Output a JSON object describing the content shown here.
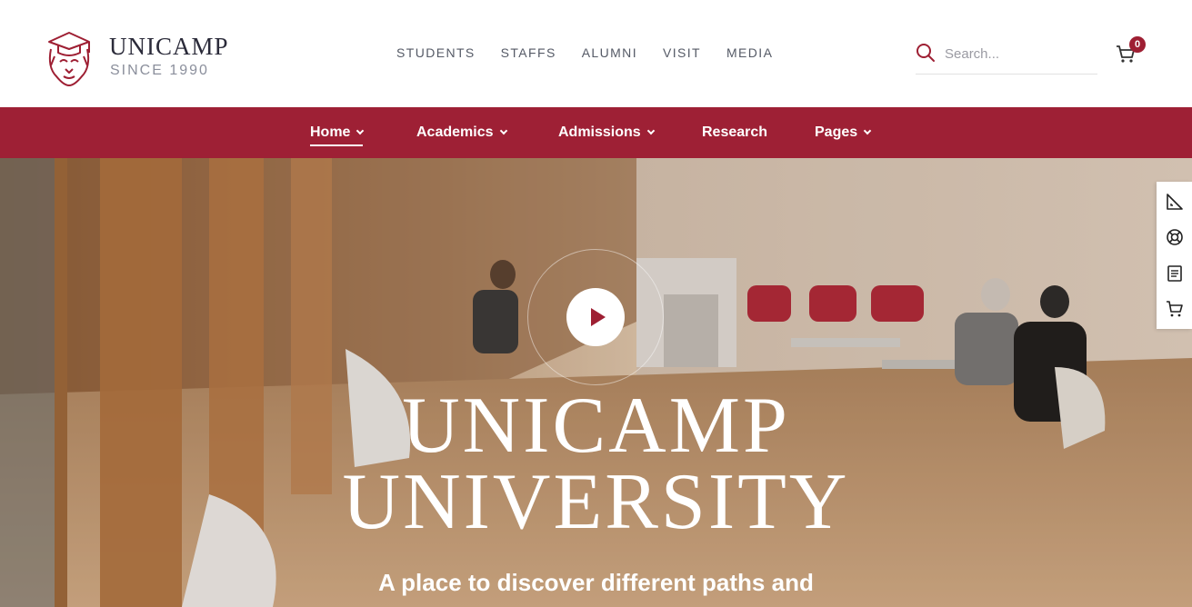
{
  "brand": {
    "name": "UNICAMP",
    "since": "SINCE 1990",
    "colors": {
      "primary": "#9e2035",
      "text": "#2b2b3a"
    }
  },
  "topnav": {
    "items": [
      "STUDENTS",
      "STAFFS",
      "ALUMNI",
      "VISIT",
      "MEDIA"
    ]
  },
  "search": {
    "placeholder": "Search...",
    "icon": "search-icon"
  },
  "cart": {
    "count": "0",
    "icon": "cart-icon"
  },
  "mainnav": {
    "items": [
      {
        "label": "Home",
        "has_dropdown": true,
        "active": true
      },
      {
        "label": "Academics",
        "has_dropdown": true
      },
      {
        "label": "Admissions",
        "has_dropdown": true
      },
      {
        "label": "Research",
        "has_dropdown": false
      },
      {
        "label": "Pages",
        "has_dropdown": true
      }
    ]
  },
  "hero": {
    "title_line1": "UNICAMP",
    "title_line2": "UNIVERSITY",
    "subtitle": "A place to discover different paths and",
    "play_icon": "play-icon"
  },
  "sidetools": [
    "ruler-icon",
    "lifebuoy-icon",
    "document-icon",
    "cart-icon"
  ]
}
